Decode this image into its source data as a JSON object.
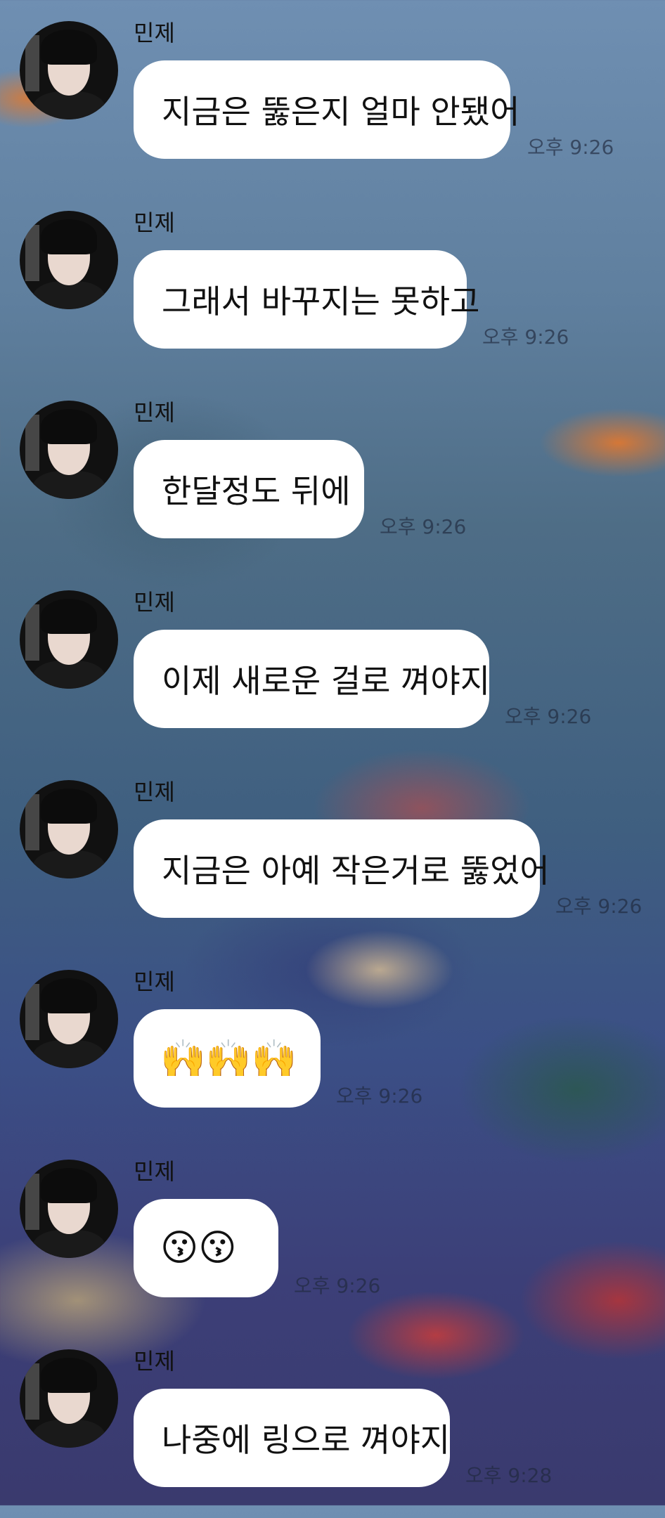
{
  "messages": [
    {
      "sender": "민제",
      "text": "지금은 뚫은지 얼마 안됐어",
      "time": "오후 9:26"
    },
    {
      "sender": "민제",
      "text": "그래서 바꾸지는 못하고",
      "time": "오후 9:26"
    },
    {
      "sender": "민제",
      "text": "한달정도 뒤에",
      "time": "오후 9:26"
    },
    {
      "sender": "민제",
      "text": "이제 새로운 걸로 껴야지",
      "time": "오후 9:26"
    },
    {
      "sender": "민제",
      "text": "지금은 아예 작은거로 뚫었어",
      "time": "오후 9:26"
    },
    {
      "sender": "민제",
      "text": "🙌🙌🙌",
      "time": "오후 9:26"
    },
    {
      "sender": "민제",
      "text": "😗😗",
      "time": "오후 9:26"
    },
    {
      "sender": "민제",
      "text": "나중에 링으로 껴야지",
      "time": "오후 9:28"
    }
  ]
}
